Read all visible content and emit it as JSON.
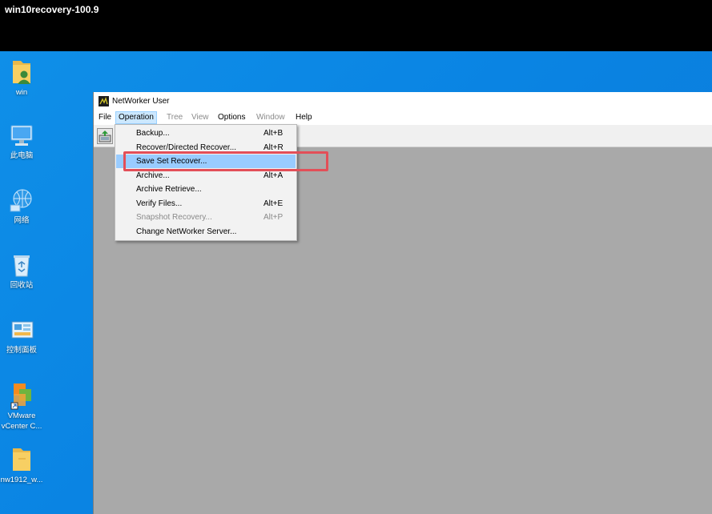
{
  "session": {
    "title": "win10recovery-100.9"
  },
  "desktop": {
    "icons": [
      {
        "label": "win",
        "icon": "user-folder-icon"
      },
      {
        "label": "此电脑",
        "icon": "computer-icon"
      },
      {
        "label": "网络",
        "icon": "network-globe-icon"
      },
      {
        "label": "回收站",
        "icon": "recycle-bin-icon"
      },
      {
        "label": "控制面板",
        "icon": "control-panel-icon"
      },
      {
        "label": "VMware",
        "label2": "vCenter C...",
        "icon": "vmware-icon"
      },
      {
        "label": "nw1912_w...",
        "icon": "folder-icon"
      }
    ]
  },
  "app": {
    "title": "NetWorker User",
    "menu": {
      "file": "File",
      "operation": "Operation",
      "tree": "Tree",
      "view": "View",
      "options": "Options",
      "window": "Window",
      "help": "Help"
    },
    "toolbar_icon": "backup-toolbar-icon"
  },
  "operation_menu": {
    "items": [
      {
        "label": "Backup...",
        "shortcut": "Alt+B",
        "enabled": true
      },
      {
        "label": "Recover/Directed Recover...",
        "shortcut": "Alt+R",
        "enabled": true
      },
      {
        "label": "Save Set Recover...",
        "shortcut": "",
        "enabled": true,
        "highlighted": true
      },
      {
        "label": "Archive...",
        "shortcut": "Alt+A",
        "enabled": true
      },
      {
        "label": "Archive Retrieve...",
        "shortcut": "",
        "enabled": true
      },
      {
        "label": "Verify Files...",
        "shortcut": "Alt+E",
        "enabled": true
      },
      {
        "label": "Snapshot Recovery...",
        "shortcut": "Alt+P",
        "enabled": false
      },
      {
        "label": "Change NetWorker Server...",
        "shortcut": "",
        "enabled": true
      }
    ]
  },
  "colors": {
    "desktop": "#0a84e3",
    "window_background": "#a9a9a9",
    "menu_highlight": "#99ccff",
    "focus_box": "#e34f58"
  }
}
